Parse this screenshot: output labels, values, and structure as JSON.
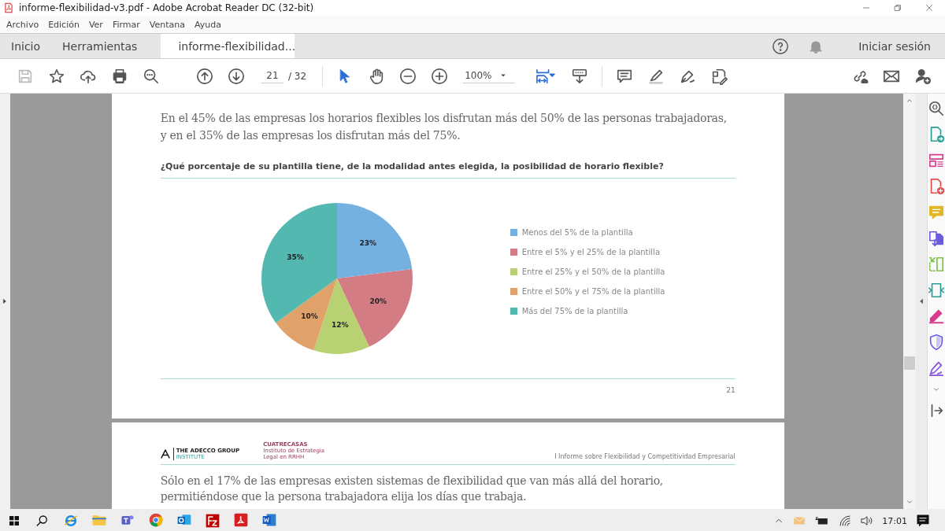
{
  "window": {
    "title": "informe-flexibilidad-v3.pdf - Adobe Acrobat Reader DC (32-bit)"
  },
  "menu": [
    "Archivo",
    "Edición",
    "Ver",
    "Firmar",
    "Ventana",
    "Ayuda"
  ],
  "tabs": [
    {
      "label": "Inicio",
      "selected": false
    },
    {
      "label": "Herramientas",
      "selected": false
    },
    {
      "label": "informe-flexibilidad...",
      "selected": true
    }
  ],
  "sign_in": "Iniciar sesión",
  "toolbar": {
    "page": "21",
    "page_total": "/ 32",
    "zoom": "100%"
  },
  "page1": {
    "paragraph": "En el 45% de las empresas los horarios flexibles los disfrutan más del 50% de las personas trabajadoras, y en el 35% de las empresas los disfrutan más del 75%.",
    "chart_data": {
      "type": "pie",
      "title": "¿Qué porcentaje de su plantilla tiene, de la modalidad antes elegida, la posibilidad de horario flexible?",
      "categories": [
        "Menos del 5% de la plantilla",
        "Entre el 5% y el 25% de la plantilla",
        "Entre el 25% y el 50% de la plantilla",
        "Entre el 50% y el 75% de la plantilla",
        "Más del 75% de la plantilla"
      ],
      "values": [
        23,
        20,
        12,
        10,
        35
      ],
      "value_labels": [
        "23%",
        "20%",
        "12%",
        "10%",
        "35%"
      ],
      "colors": [
        "#74b0e0",
        "#d47c84",
        "#b8d172",
        "#e0a16a",
        "#52b8b0"
      ],
      "legend": "right"
    },
    "page_number": "21"
  },
  "page2": {
    "logo1": [
      "THE ADECCO GROUP",
      "INSTITUTE"
    ],
    "logo2": [
      "CUATRECASAS",
      "Instituto de Estrategia Legal en RRHH"
    ],
    "header": "I Informe sobre Flexibilidad y Competitividad Empresarial",
    "paragraph": "Sólo en el 17% de las empresas existen sistemas de flexibilidad que van más allá del horario, permitiéndose que la persona trabajadora elija los días que trabaja."
  },
  "taskbar": {
    "clock": "17:01"
  }
}
